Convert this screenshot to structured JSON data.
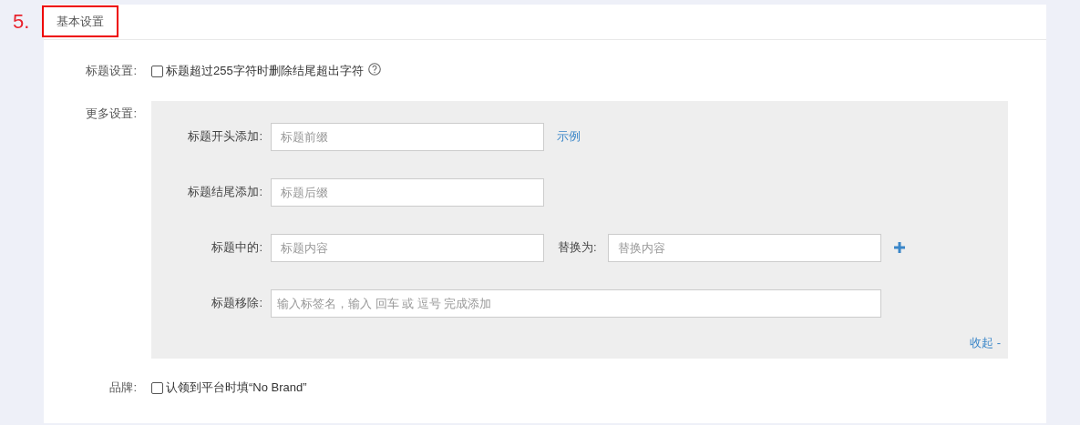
{
  "step_number": "5.",
  "section_title": "基本设置",
  "title_setting": {
    "label": "标题设置:",
    "checkbox": {
      "label": "标题超过255字符时删除结尾超出字符",
      "checked": false
    }
  },
  "more_settings": {
    "label": "更多设置:",
    "rows": [
      {
        "kind": "prefix",
        "label": "标题开头添加:",
        "placeholder": "标题前缀",
        "link": "示例"
      },
      {
        "kind": "suffix",
        "label": "标题结尾添加:",
        "placeholder": "标题后缀"
      },
      {
        "kind": "replace",
        "label": "标题中的:",
        "placeholder": "标题内容",
        "replace_label": "替换为:",
        "replace_placeholder": "替换内容"
      },
      {
        "kind": "remove",
        "label": "标题移除:",
        "placeholder": "输入标签名，输入 回车 或 逗号 完成添加"
      }
    ],
    "collapse_link": "收起 -"
  },
  "brand": {
    "label": "品牌:",
    "checkbox": {
      "label": "认领到平台时填“No Brand”",
      "checked": false
    }
  }
}
